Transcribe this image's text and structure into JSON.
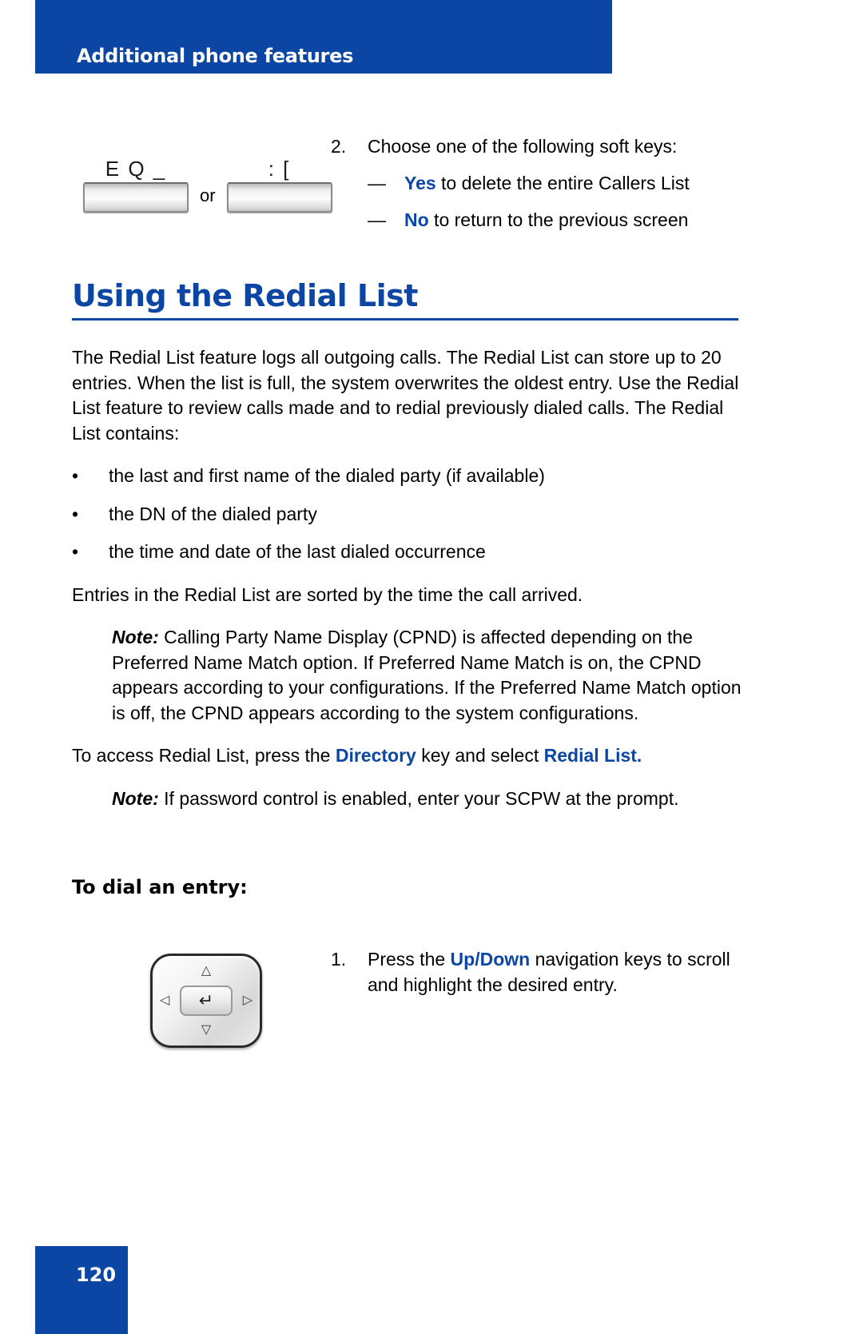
{
  "header": {
    "title": "Additional phone features",
    "band_color": "#0b46a5"
  },
  "step2": {
    "number": "2.",
    "instruction": "Choose one of the following soft keys:",
    "options": [
      {
        "dash": "—",
        "key": "Yes",
        "text": " to delete the entire Callers List"
      },
      {
        "dash": "—",
        "key": "No",
        "text": " to return to the previous screen"
      }
    ]
  },
  "softkeys": {
    "left_label": "E Q _",
    "or_label": "or",
    "right_label": ": [",
    "left_icon": "softkey-button-icon",
    "right_icon": "softkey-button-icon"
  },
  "section": {
    "heading": "Using the Redial List"
  },
  "body": {
    "intro": "The Redial List feature logs all outgoing calls. The Redial List can store up to 20 entries. When the list is full, the system overwrites the oldest entry. Use the Redial List feature to review calls made and to redial previously dialed calls. The Redial List contains:",
    "bullet_marker": "•",
    "bullets": [
      "the last and first name of the dialed party (if available)",
      "the DN of the dialed party",
      "the time and date of the last dialed occurrence"
    ],
    "sorted_text": "Entries in the Redial List are sorted by the time the call arrived.",
    "note1_label": "Note:",
    "note1_text": " Calling Party Name Display (CPND) is affected depending on the Preferred Name Match option. If Preferred Name Match is on, the CPND appears according to your configurations. If the Preferred Name Match option is off, the CPND appears according to the system configurations.",
    "access_prefix": "To access Redial List, press the ",
    "access_key1": "Directory",
    "access_middle": " key and select ",
    "access_key2": "Redial List.",
    "note2_label": "Note:",
    "note2_text": " If password control is enabled, enter your SCPW at the prompt."
  },
  "dial_entry": {
    "subheading": "To dial an entry:",
    "step_number": "1.",
    "step_prefix": "Press the ",
    "step_key": "Up/Down",
    "step_suffix": " navigation keys to scroll and highlight the desired entry.",
    "navkey_icon": "navigation-key-icon",
    "navkey_up": "△",
    "navkey_down": "▽",
    "navkey_left": "◁",
    "navkey_right": "▷",
    "navkey_center": "↵"
  },
  "footer": {
    "page_number": "120"
  },
  "colors": {
    "brand_blue": "#0b46a5",
    "text_black": "#000000"
  }
}
